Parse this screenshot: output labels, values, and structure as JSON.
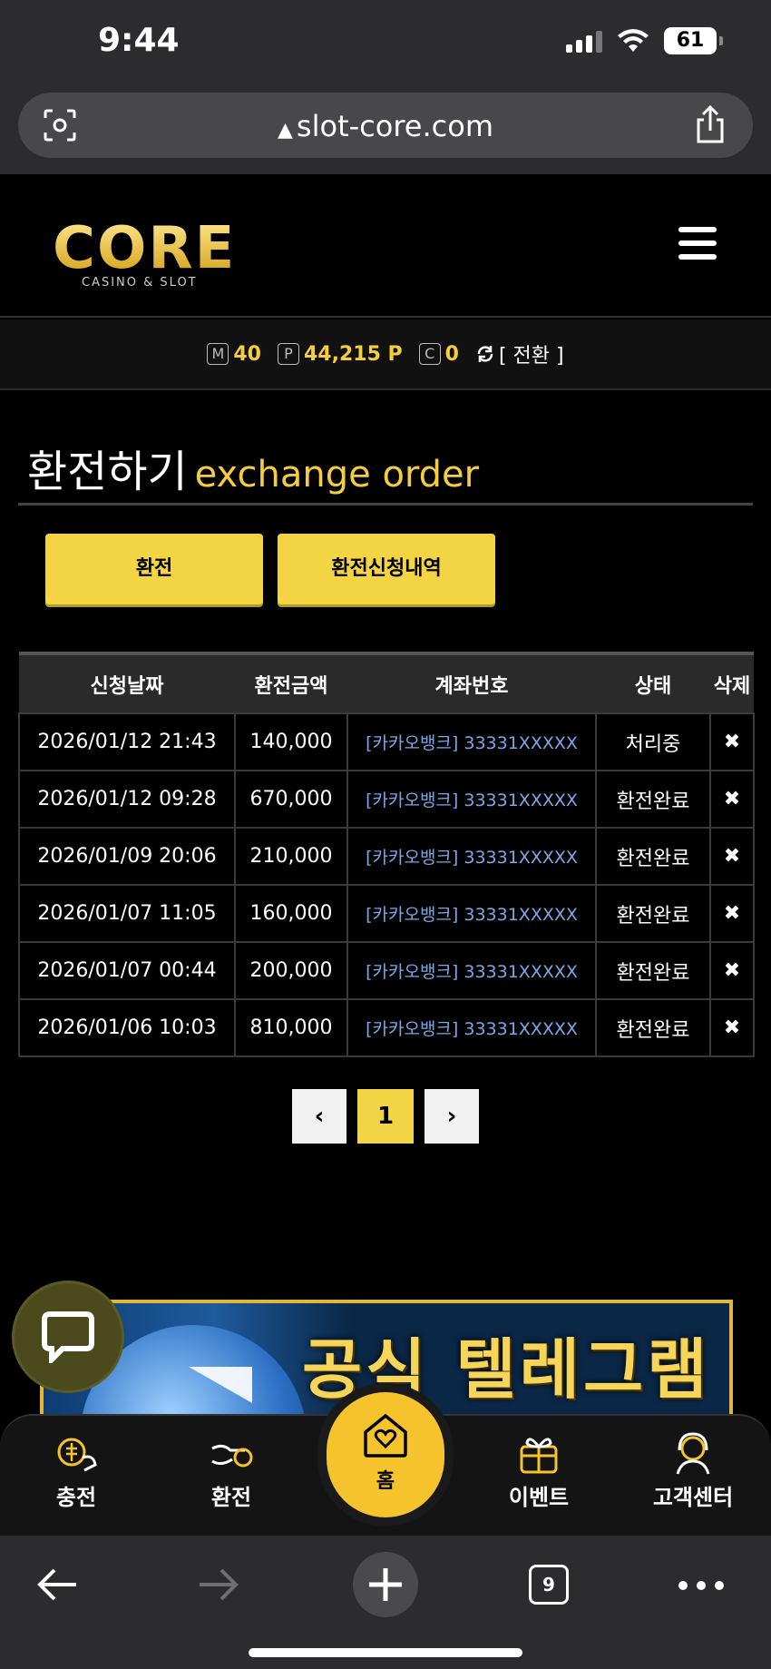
{
  "status_bar": {
    "time": "9:44",
    "battery": "61"
  },
  "browser": {
    "url": "slot-core.com"
  },
  "header": {
    "logo_main": "CORE",
    "logo_sub": "CASINO & SLOT"
  },
  "balance": {
    "m_badge": "M",
    "m_value": "40",
    "p_badge": "P",
    "p_value": "44,215 P",
    "c_badge": "C",
    "c_value": "0",
    "swap_label": "[ 전환 ]"
  },
  "page": {
    "title_ko": "환전하기",
    "title_en": "exchange order"
  },
  "buttons": {
    "exchange": "환전",
    "history": "환전신청내역"
  },
  "table": {
    "headers": [
      "신청날짜",
      "환전금액",
      "계좌번호",
      "상태",
      "삭제"
    ],
    "rows": [
      {
        "date": "2026/01/12 21:43",
        "amount": "140,000",
        "account": "[카카오뱅크] 33331XXXXX",
        "status": "처리중"
      },
      {
        "date": "2026/01/12 09:28",
        "amount": "670,000",
        "account": "[카카오뱅크] 33331XXXXX",
        "status": "환전완료"
      },
      {
        "date": "2026/01/09 20:06",
        "amount": "210,000",
        "account": "[카카오뱅크] 33331XXXXX",
        "status": "환전완료"
      },
      {
        "date": "2026/01/07 11:05",
        "amount": "160,000",
        "account": "[카카오뱅크] 33331XXXXX",
        "status": "환전완료"
      },
      {
        "date": "2026/01/07 00:44",
        "amount": "200,000",
        "account": "[카카오뱅크] 33331XXXXX",
        "status": "환전완료"
      },
      {
        "date": "2026/01/06 10:03",
        "amount": "810,000",
        "account": "[카카오뱅크] 33331XXXXX",
        "status": "환전완료"
      }
    ],
    "delete_glyph": "✖"
  },
  "pagination": {
    "prev": "‹",
    "current": "1",
    "next": "›"
  },
  "banner": {
    "text": "공식 텔레그램"
  },
  "tabbar": {
    "charge": "충전",
    "exchange": "환전",
    "home": "홈",
    "event": "이벤트",
    "support": "고객센터"
  },
  "safari": {
    "tab_count": "9"
  },
  "colors": {
    "accent": "#f2d445",
    "gold_text": "#f5cd3d",
    "link_blue": "#7aa7e8"
  }
}
